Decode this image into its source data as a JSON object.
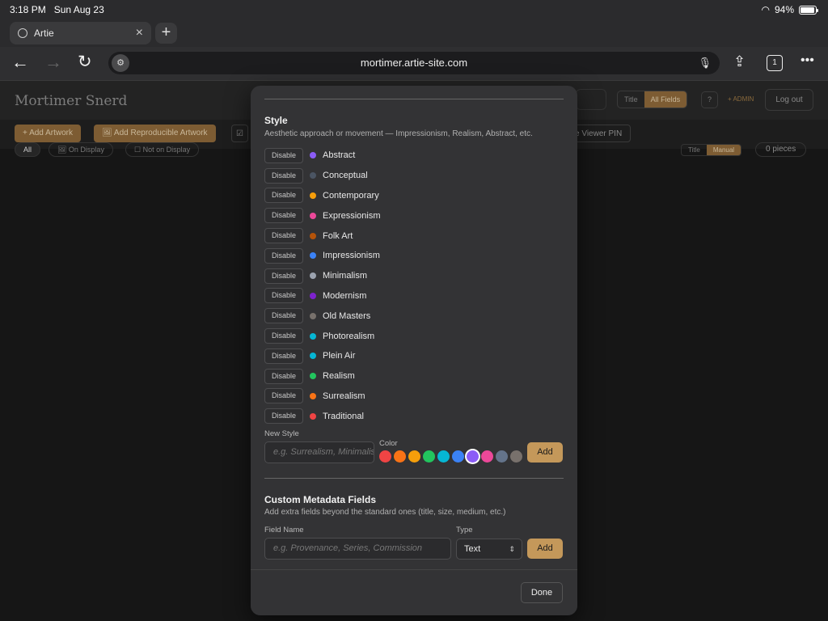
{
  "status": {
    "time": "3:18 PM",
    "date": "Sun Aug 23",
    "battery": "94%",
    "battery_level": 0.94
  },
  "browser": {
    "tab_title": "Artie",
    "url": "mortimer.artie-site.com",
    "tab_count": "1"
  },
  "page": {
    "brand": "Mortimer Snerd",
    "search_mode": [
      "Title",
      "All Fields"
    ],
    "help": "?",
    "admin_label": "+ ADMIN",
    "logout": "Log out",
    "actions": {
      "add_artwork": "+ Add Artwork",
      "add_repro": "🖼 Add Reproducible Artwork",
      "checkbox": "☑",
      "viewer_pin": "e Viewer PIN"
    },
    "filters": {
      "all": "All",
      "on_display": "🖼 On Display",
      "not_on_display": "☐ Not on Display"
    },
    "sort": [
      "Title",
      "Manual"
    ],
    "pieces": "0 pieces"
  },
  "modal": {
    "style_section": {
      "title": "Style",
      "description": "Aesthetic approach or movement — Impressionism, Realism, Abstract, etc.",
      "disable_label": "Disable",
      "items": [
        {
          "name": "Abstract",
          "color": "#8b5cf6"
        },
        {
          "name": "Conceptual",
          "color": "#4b5563"
        },
        {
          "name": "Contemporary",
          "color": "#f59e0b"
        },
        {
          "name": "Expressionism",
          "color": "#ec4899"
        },
        {
          "name": "Folk Art",
          "color": "#b45309"
        },
        {
          "name": "Impressionism",
          "color": "#3b82f6"
        },
        {
          "name": "Minimalism",
          "color": "#9ca3af"
        },
        {
          "name": "Modernism",
          "color": "#7e22ce"
        },
        {
          "name": "Old Masters",
          "color": "#78716c"
        },
        {
          "name": "Photorealism",
          "color": "#06b6d4"
        },
        {
          "name": "Plein Air",
          "color": "#06b6d4"
        },
        {
          "name": "Realism",
          "color": "#22c55e"
        },
        {
          "name": "Surrealism",
          "color": "#f97316"
        },
        {
          "name": "Traditional",
          "color": "#ef4444"
        }
      ],
      "new_label": "New Style",
      "new_placeholder": "e.g. Surrealism, Minimalism",
      "color_label": "Color",
      "palette": [
        "#ef4444",
        "#f97316",
        "#f59e0b",
        "#22c55e",
        "#06b6d4",
        "#3b82f6",
        "#8b5cf6",
        "#ec4899",
        "#64748b",
        "#78716c"
      ],
      "selected_color_index": 6,
      "add_label": "Add"
    },
    "custom_section": {
      "title": "Custom Metadata Fields",
      "description": "Add extra fields beyond the standard ones (title, size, medium, etc.)",
      "field_name_label": "Field Name",
      "field_name_placeholder": "e.g. Provenance, Series, Commission",
      "type_label": "Type",
      "type_value": "Text",
      "add_label": "Add"
    },
    "done_label": "Done"
  }
}
